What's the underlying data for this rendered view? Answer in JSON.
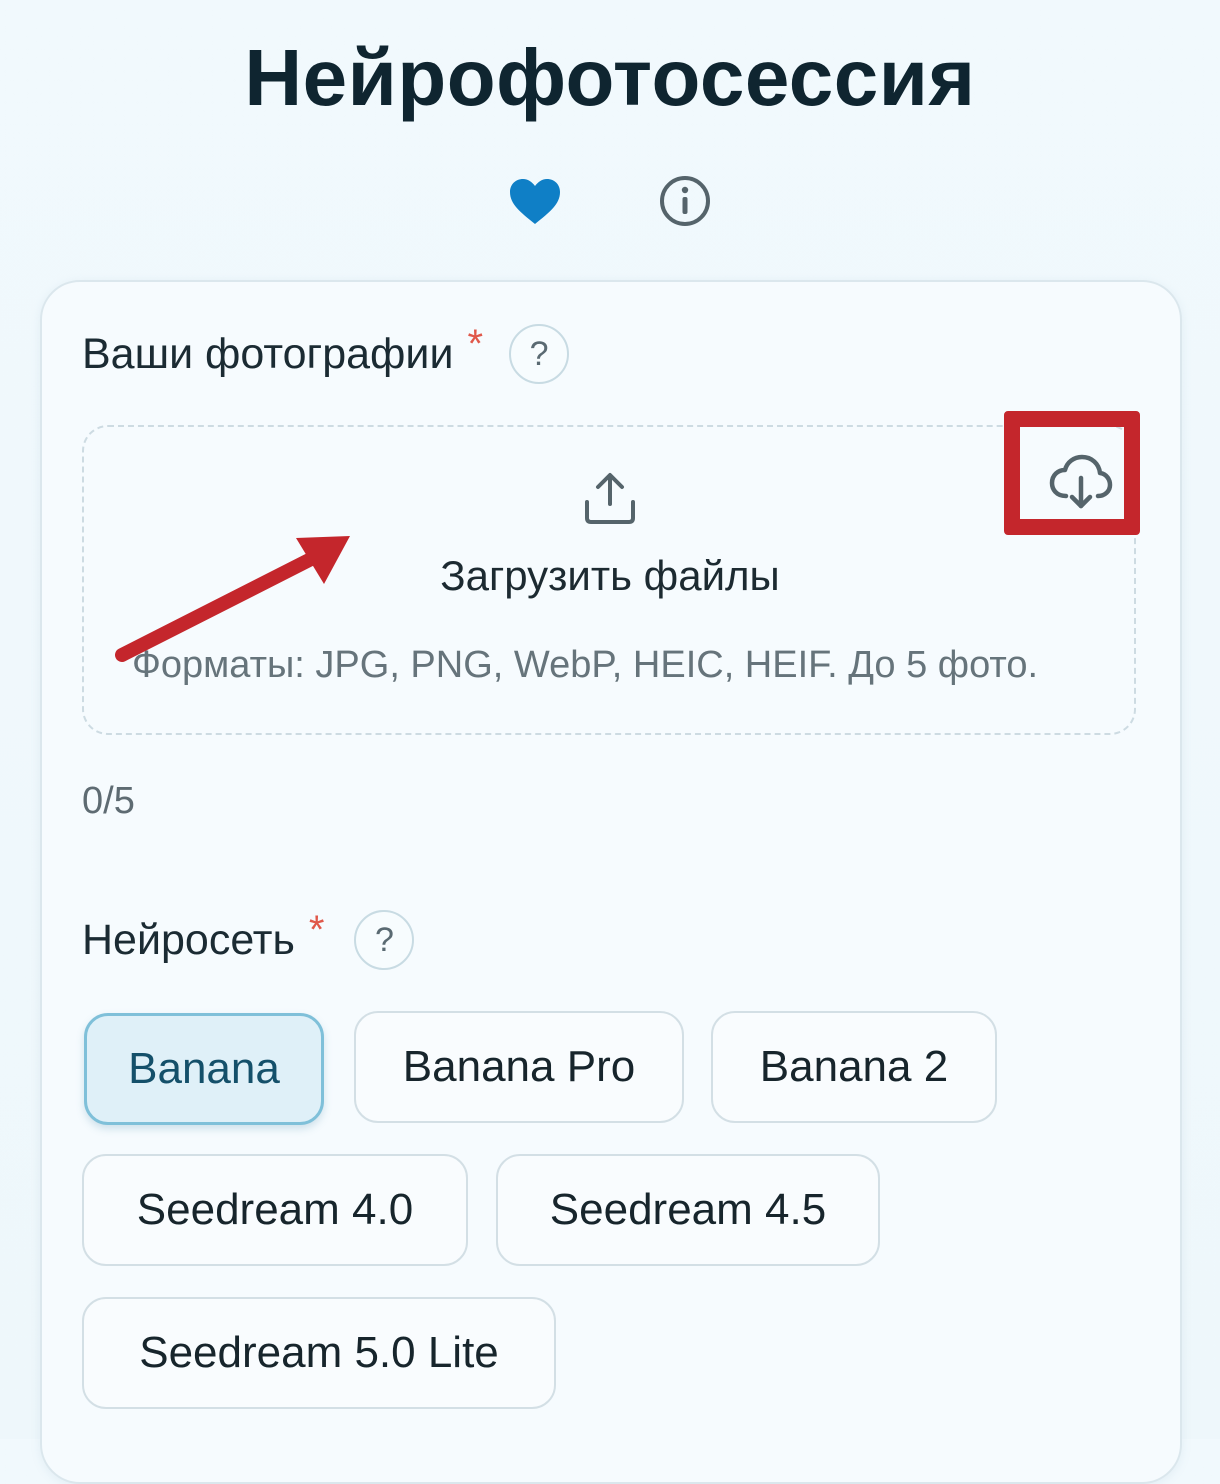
{
  "page": {
    "title": "Нейрофотосессия"
  },
  "header_icons": [
    {
      "name": "heart-icon",
      "color": "#0f7fc6"
    },
    {
      "name": "info-icon",
      "color": "#5e6b72"
    }
  ],
  "photos_section": {
    "label": "Ваши фотографии",
    "required_mark": "*",
    "help_label": "?",
    "dropzone": {
      "upload_icon": "upload-icon",
      "upload_label": "Загрузить файлы",
      "formats": "Форматы: JPG, PNG, WebP, HEIC, HEIF. До 5 фото.",
      "import_icon": "cloud-download-icon"
    },
    "counter": "0/5"
  },
  "model_section": {
    "label": "Нейросеть",
    "required_mark": "*",
    "help_label": "?",
    "options": [
      {
        "label": "Banana",
        "selected": true
      },
      {
        "label": "Banana Pro",
        "selected": false
      },
      {
        "label": "Banana 2",
        "selected": false
      },
      {
        "label": "Seedream 4.0",
        "selected": false
      },
      {
        "label": "Seedream 4.5",
        "selected": false
      },
      {
        "label": "Seedream 5.0 Lite",
        "selected": false
      }
    ]
  },
  "annotations": {
    "highlight_color": "#c4262c"
  }
}
